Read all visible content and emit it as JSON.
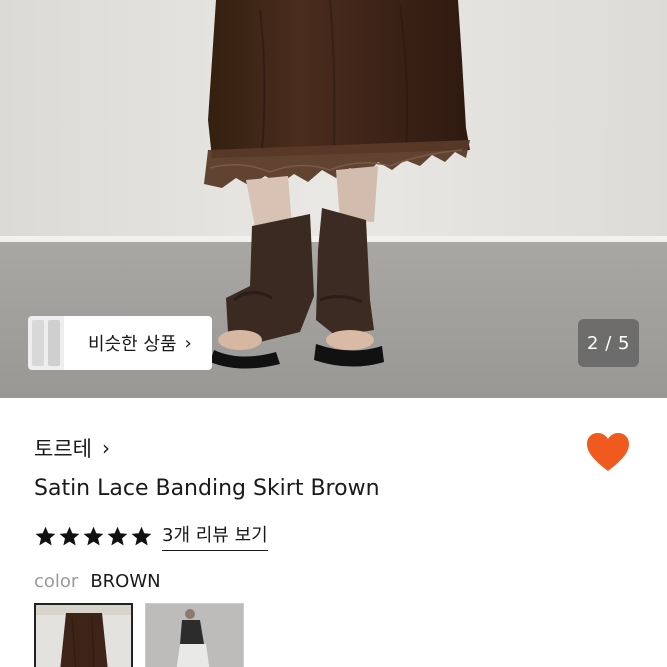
{
  "gallery": {
    "similar_button_label": "비슷한 상품",
    "similar_chevron": "›",
    "page_indicator": "2 / 5"
  },
  "product": {
    "shop_name": "토르테",
    "shop_chevron": "›",
    "title": "Satin Lace Banding Skirt Brown",
    "rating": 5,
    "review_link": "3개 리뷰 보기",
    "color_label": "color",
    "color_value": "BROWN",
    "liked": true,
    "colors": {
      "heart": "#f15a1f",
      "skirt": "#3e2318",
      "star": "#111111"
    }
  },
  "swatches": [
    {
      "name": "brown",
      "selected": true
    },
    {
      "name": "gray",
      "selected": false
    }
  ]
}
